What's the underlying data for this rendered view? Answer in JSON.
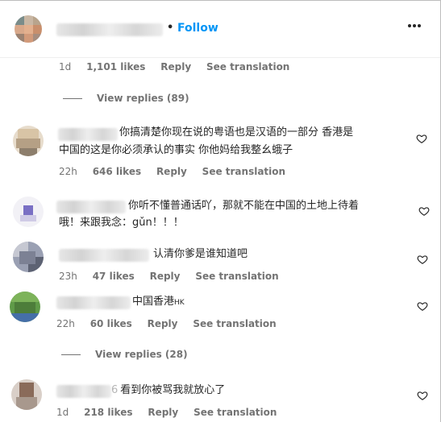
{
  "header": {
    "separator": "•",
    "follow_label": "Follow",
    "more_icon": "⋯"
  },
  "post_meta": {
    "time": "1d",
    "likes": "1,101 likes",
    "reply": "Reply",
    "see_translation": "See translation"
  },
  "view_replies_1": "View replies (89)",
  "view_replies_2": "View replies (28)",
  "comments": [
    {
      "line1": "你搞清楚你现在说的粤语也是汉语的一部分 香港是",
      "line2": "中国的这是你必须承认的事实 你他妈给我整幺蛾子",
      "time": "22h",
      "likes": "646 likes",
      "reply": "Reply",
      "see_translation": "See translation"
    },
    {
      "line1": "你听不懂普通话吖，那就不能在中国的土地上待着",
      "line2": "哦！来跟我念：gǔn！！！"
    },
    {
      "line1": "认清你爹是谁知道吧",
      "time": "23h",
      "likes": "47 likes",
      "reply": "Reply",
      "see_translation": "See translation"
    },
    {
      "line1": "中国香港",
      "line1_suffix": "HK",
      "time": "22h",
      "likes": "60 likes",
      "reply": "Reply",
      "see_translation": "See translation"
    },
    {
      "username_fragment": "6",
      "line1": "看到你被骂我就放心了",
      "time": "1d",
      "likes": "218 likes",
      "reply": "Reply",
      "see_translation": "See translation"
    }
  ],
  "colors": {
    "follow": "#0095f6",
    "meta": "#737373",
    "text": "#262626"
  }
}
